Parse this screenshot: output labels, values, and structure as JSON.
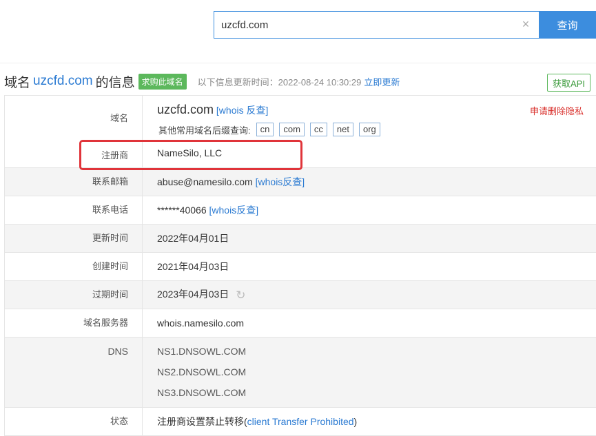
{
  "search": {
    "value": "uzcfd.com",
    "clear_icon": "×",
    "button_label": "查询"
  },
  "header": {
    "prefix": "域名",
    "domain": "uzcfd.com",
    "suffix": "的信息",
    "buy_badge": "求购此域名",
    "update_text": "以下信息更新时间：2022-08-24 10:30:29",
    "update_link": "立即更新",
    "api_button": "获取API"
  },
  "domain_row": {
    "label": "域名",
    "name": "uzcfd.com",
    "reverse_link": "[whois 反查]",
    "privacy_link": "申请删除隐私",
    "tld_label": "其他常用域名后缀查询:",
    "tlds": [
      "cn",
      "com",
      "cc",
      "net",
      "org"
    ]
  },
  "registrar": {
    "label": "注册商",
    "value": "NameSilo, LLC"
  },
  "email": {
    "label": "联系邮箱",
    "value": "abuse@namesilo.com",
    "link": "[whois反查]"
  },
  "phone": {
    "label": "联系电话",
    "value": "******40066",
    "link": "[whois反查]"
  },
  "updated": {
    "label": "更新时间",
    "value": "2022年04月01日"
  },
  "created": {
    "label": "创建时间",
    "value": "2021年04月03日"
  },
  "expires": {
    "label": "过期时间",
    "value": "2023年04月03日",
    "icon": "refresh-icon"
  },
  "whois_server": {
    "label": "域名服务器",
    "value": "whois.namesilo.com"
  },
  "dns": {
    "label": "DNS",
    "servers": [
      "NS1.DNSOWL.COM",
      "NS2.DNSOWL.COM",
      "NS3.DNSOWL.COM"
    ]
  },
  "status": {
    "label": "状态",
    "prefix": "注册商设置禁止转移(",
    "link": "client Transfer Prohibited",
    "suffix": ")"
  },
  "colors": {
    "accent": "#3c8dde",
    "link": "#2a7ad2",
    "badge": "#5cb85c",
    "highlight": "#e0343a",
    "privacy": "#d9302c"
  }
}
